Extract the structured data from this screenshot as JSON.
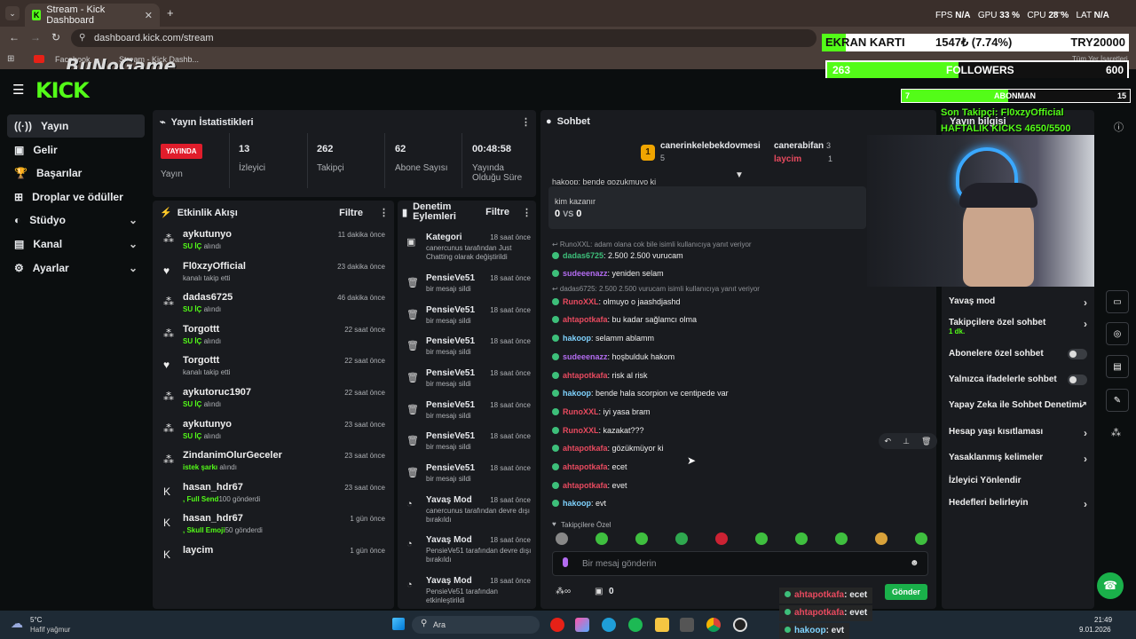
{
  "browser": {
    "tab_title": "Stream - Kick Dashboard",
    "url": "dashboard.kick.com/stream",
    "bookmarks": [
      "Facebook",
      "Stream - Kick Dashb..."
    ],
    "bookmark_right": "Tüm Yer İşaretleri"
  },
  "overlay": {
    "brand": "BuNoGame",
    "hud": {
      "fps_label": "FPS",
      "fps": "N/A",
      "gpu_label": "GPU",
      "gpu": "33 %",
      "cpu_label": "CPU",
      "cpu": "28 %",
      "lat_label": "LAT",
      "lat": "N/A"
    },
    "ekran": {
      "label": "EKRAN KARTI",
      "price": "1547₺ (7.74%)",
      "goal": "TRY20000"
    },
    "followers": {
      "count": "263",
      "label": "FOLLOWERS",
      "goal": "600"
    },
    "abonman": {
      "count": "7",
      "label": "ABONMAN",
      "goal": "15"
    },
    "last_follower": "Son Takipçi: Fl0xzyOfficial",
    "weekly_kicks": "HAFTALIK KICKS 4650/5500",
    "chat_overlay": [
      {
        "user": "ahtapotkafa",
        "text": ": ecet",
        "color": "#e84a5f"
      },
      {
        "user": "ahtapotkafa",
        "text": ": evet",
        "color": "#e84a5f"
      },
      {
        "user": "hakoop",
        "text": ": evt",
        "color": "#7fd3ff"
      }
    ],
    "send_button": "Gönder"
  },
  "nav": {
    "items": [
      {
        "label": "Yayın",
        "icon": "((·))"
      },
      {
        "label": "Gelir",
        "icon": "▣"
      },
      {
        "label": "Başarılar",
        "icon": "🏆"
      },
      {
        "label": "Droplar ve ödüller",
        "icon": "⊞"
      },
      {
        "label": "Stüdyo",
        "icon": "◐"
      },
      {
        "label": "Kanal",
        "icon": "▤"
      },
      {
        "label": "Ayarlar",
        "icon": "⚙"
      }
    ]
  },
  "stats": {
    "title": "Yayın İstatistikleri",
    "live_badge": "YAYINDA",
    "items": [
      {
        "value": "",
        "label": "Yayın"
      },
      {
        "value": "13",
        "label": "İzleyici"
      },
      {
        "value": "262",
        "label": "Takipçi"
      },
      {
        "value": "62",
        "label": "Abone Sayısı"
      },
      {
        "value": "00:48:58",
        "label": "Yayında Olduğu Süre"
      }
    ]
  },
  "activity": {
    "title": "Etkinlik Akışı",
    "filter": "Filtre",
    "events": [
      {
        "name": "aykutunyo",
        "sub_b": "SU İÇ",
        "sub": " alındı",
        "time": "11 dakika önce",
        "icon": "⁂"
      },
      {
        "name": "Fl0xzyOfficial",
        "sub_b": "",
        "sub": "kanalı takip etti",
        "time": "23 dakika önce",
        "icon": "♥"
      },
      {
        "name": "dadas6725",
        "sub_b": "SU İÇ",
        "sub": " alındı",
        "time": "46 dakika önce",
        "icon": "⁂"
      },
      {
        "name": "Torgottt",
        "sub_b": "SU İÇ",
        "sub": " alındı",
        "time": "22 saat önce",
        "icon": "⁂"
      },
      {
        "name": "Torgottt",
        "sub_b": "",
        "sub": "kanalı takip etti",
        "time": "22 saat önce",
        "icon": "♥"
      },
      {
        "name": "aykutoruc1907",
        "sub_b": "SU İÇ",
        "sub": " alındı",
        "time": "22 saat önce",
        "icon": "⁂"
      },
      {
        "name": "aykutunyo",
        "sub_b": "SU İÇ",
        "sub": " alındı",
        "time": "23 saat önce",
        "icon": "⁂"
      },
      {
        "name": "ZindanimOlurGeceler",
        "sub_b": "istek şarkı",
        "sub": " alındı",
        "time": "23 saat önce",
        "icon": "⁂"
      },
      {
        "name": "hasan_hdr67",
        "sub_b": ", Full Send",
        "sub": "100 gönderdi",
        "time": "23 saat önce",
        "icon": "K"
      },
      {
        "name": "hasan_hdr67",
        "sub_b": ", Skull Emoji",
        "sub": "50 gönderdi",
        "time": "1 gün önce",
        "icon": "K"
      },
      {
        "name": "laycim",
        "sub_b": "",
        "sub": "",
        "time": "1 gün önce",
        "icon": "K"
      }
    ]
  },
  "moderation": {
    "title": "Denetim Eylemleri",
    "filter": "Filtre",
    "actions": [
      {
        "name": "Kategori",
        "sub": "canercunus tarafından Just Chatting olarak değiştirildi",
        "time": "18 saat önce",
        "icon": "▣"
      },
      {
        "name": "PensieVe51",
        "sub": "bir mesajı sildi",
        "time": "18 saat önce",
        "icon": "🗑"
      },
      {
        "name": "PensieVe51",
        "sub": "bir mesajı sildi",
        "time": "18 saat önce",
        "icon": "🗑"
      },
      {
        "name": "PensieVe51",
        "sub": "bir mesajı sildi",
        "time": "18 saat önce",
        "icon": "🗑"
      },
      {
        "name": "PensieVe51",
        "sub": "bir mesajı sildi",
        "time": "18 saat önce",
        "icon": "🗑"
      },
      {
        "name": "PensieVe51",
        "sub": "bir mesajı sildi",
        "time": "18 saat önce",
        "icon": "🗑"
      },
      {
        "name": "PensieVe51",
        "sub": "bir mesajı sildi",
        "time": "18 saat önce",
        "icon": "🗑"
      },
      {
        "name": "PensieVe51",
        "sub": "bir mesajı sildi",
        "time": "18 saat önce",
        "icon": "🗑"
      },
      {
        "name": "Yavaş Mod",
        "sub": "canercunus tarafından devre dışı bırakıldı",
        "time": "18 saat önce",
        "icon": "◔"
      },
      {
        "name": "Yavaş Mod",
        "sub": "PensieVe51 tarafından devre dışı bırakıldı",
        "time": "18 saat önce",
        "icon": "◔"
      },
      {
        "name": "Yavaş Mod",
        "sub": "PensieVe51 tarafından etkinleştirildi",
        "time": "18 saat önce",
        "icon": "◔"
      }
    ]
  },
  "chat": {
    "title": "Sohbet",
    "top_gifters": [
      {
        "rank": "1",
        "name": "canerinkelebekdovmesi",
        "count": "5"
      },
      {
        "name": "canerabifan",
        "count": "3"
      },
      {
        "name": "laycim",
        "count": "1"
      }
    ],
    "pinned_partial": "hakoop: bende gozukmuyo ki",
    "poll": {
      "question": "kim kazanır",
      "left": "0",
      "vs": "VS",
      "right": "0"
    },
    "messages": [
      {
        "type": "sys",
        "text": "↩ RunoXXL: adam olana cok bile isimli kullanıcıya yanıt veriyor"
      },
      {
        "type": "msg",
        "user": "dadas6725",
        "color": "#3dbf7a",
        "text": ": 2.500 2.500 vurucam"
      },
      {
        "type": "msg",
        "user": "sudeeenazz",
        "color": "#b36cf0",
        "text": ": yeniden selam"
      },
      {
        "type": "sys",
        "text": "↩ dadas6725: 2.500 2.500 vurucam isimli kullanıcıya yanıt veriyor"
      },
      {
        "type": "msg",
        "user": "RunoXXL",
        "color": "#e84a5f",
        "text": ": olmuyo o jaashdjashd"
      },
      {
        "type": "msg",
        "user": "ahtapotkafa",
        "color": "#e84a5f",
        "text": ": bu kadar sağlamcı olma"
      },
      {
        "type": "msg",
        "user": "hakoop",
        "color": "#7fd3ff",
        "text": ": selamm ablamm"
      },
      {
        "type": "msg",
        "user": "sudeeenazz",
        "color": "#b36cf0",
        "text": ": hoşbulduk hakom"
      },
      {
        "type": "msg",
        "user": "ahtapotkafa",
        "color": "#e84a5f",
        "text": ": risk al risk"
      },
      {
        "type": "msg",
        "user": "hakoop",
        "color": "#7fd3ff",
        "text": ": bende hala scorpion ve centipede var"
      },
      {
        "type": "msg",
        "user": "RunoXXL",
        "color": "#e84a5f",
        "text": ": iyi yasa bram"
      },
      {
        "type": "msg",
        "user": "RunoXXL",
        "color": "#e84a5f",
        "text": ": kazakat???"
      },
      {
        "type": "msg",
        "user": "ahtapotkafa",
        "color": "#e84a5f",
        "text": ": gözükmüyor ki"
      },
      {
        "type": "msg",
        "user": "ahtapotkafa",
        "color": "#e84a5f",
        "text": ": ecet"
      },
      {
        "type": "msg",
        "user": "ahtapotkafa",
        "color": "#e84a5f",
        "text": ": evet"
      },
      {
        "type": "msg",
        "user": "hakoop",
        "color": "#7fd3ff",
        "text": ": evt"
      }
    ],
    "followers_only_label": "Takipçilere Özel",
    "input_placeholder": "Bir mesaj gönderin",
    "bottom_count": "0"
  },
  "stream_info": {
    "title": "Yayın bilgisi"
  },
  "settings": [
    {
      "label": "Yavaş mod",
      "kind": "chevron"
    },
    {
      "label": "Takipçilere özel sohbet",
      "kind": "chevron",
      "sub": "1 dk."
    },
    {
      "label": "Abonelere özel sohbet",
      "kind": "toggle"
    },
    {
      "label": "Yalnızca ifadelerle sohbet",
      "kind": "toggle"
    },
    {
      "label": "Yapay Zeka ile Sohbet Denetimi",
      "kind": "link"
    },
    {
      "label": "Hesap yaşı kısıtlaması",
      "kind": "chevron"
    },
    {
      "label": "Yasaklanmış kelimeler",
      "kind": "chevron"
    },
    {
      "label": "İzleyici Yönlendir",
      "kind": "none"
    },
    {
      "label": "Hedefleri belirleyin",
      "kind": "chevron"
    }
  ],
  "taskbar": {
    "weather_temp": "5°C",
    "weather_desc": "Hafif yağmur",
    "search": "Ara",
    "time": "21:49",
    "date": "9.01.2026"
  }
}
